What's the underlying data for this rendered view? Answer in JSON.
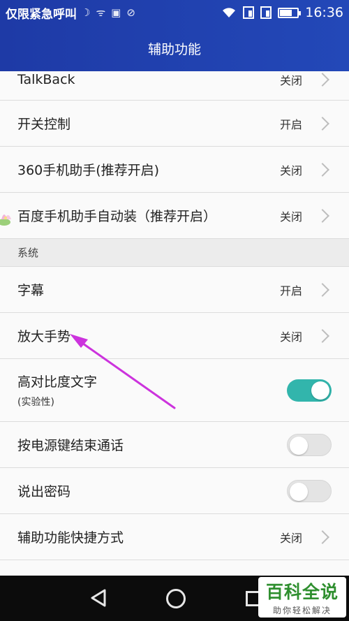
{
  "status_bar": {
    "carrier": "仅限紧急呼叫",
    "icons": [
      "moon-icon",
      "wifi-call-icon",
      "image-icon",
      "signal-off-icon"
    ],
    "right_icons": [
      "wifi-icon",
      "sim1-icon",
      "sim2-icon",
      "battery-icon"
    ],
    "battery_level": 0.7,
    "time": "16:36"
  },
  "header": {
    "title": "辅助功能"
  },
  "settings": {
    "rows": [
      {
        "label": "TalkBack",
        "value": "关闭",
        "control": "chevron"
      },
      {
        "label": "开关控制",
        "value": "开启",
        "control": "chevron"
      },
      {
        "label": "360手机助手(推荐开启)",
        "value": "关闭",
        "control": "chevron"
      },
      {
        "label": "百度手机助手自动装（推荐开启）",
        "value": "关闭",
        "control": "chevron"
      }
    ],
    "section_title": "系统",
    "system_rows": [
      {
        "label": "字幕",
        "value": "开启",
        "control": "chevron"
      },
      {
        "label": "放大手势",
        "value": "关闭",
        "control": "chevron"
      },
      {
        "label": "高对比度文字",
        "sublabel": "(实验性)",
        "control": "toggle",
        "on": true
      },
      {
        "label": "按电源键结束通话",
        "control": "toggle",
        "on": false
      },
      {
        "label": "说出密码",
        "control": "toggle",
        "on": false
      },
      {
        "label": "辅助功能快捷方式",
        "value": "关闭",
        "control": "chevron"
      }
    ]
  },
  "navigation": {
    "buttons": [
      "back-icon",
      "home-icon",
      "recent-apps-icon"
    ]
  },
  "watermark": {
    "title": "百科全说",
    "subtitle": "助你轻松解决"
  },
  "colors": {
    "header": "#2348b8",
    "toggle_on": "#32b5ac",
    "annotation_arrow": "#cc33dd",
    "watermark_green": "#2f8f2f"
  }
}
